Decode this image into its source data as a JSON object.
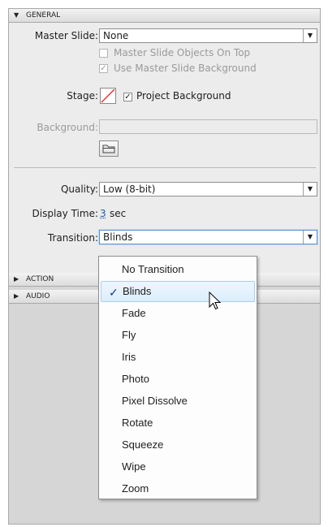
{
  "sections": {
    "general": "GENERAL",
    "action": "ACTION",
    "audio": "AUDIO"
  },
  "general": {
    "master_slide_label": "Master Slide:",
    "master_slide_value": "None",
    "master_objects_on_top": {
      "label": "Master Slide Objects On Top",
      "checked": false,
      "enabled": false
    },
    "use_master_bg": {
      "label": "Use Master Slide Background",
      "checked": true,
      "enabled": false
    },
    "stage_label": "Stage:",
    "project_background": {
      "label": "Project Background",
      "checked": true
    },
    "background_label": "Background:",
    "background_value": "",
    "quality_label": "Quality:",
    "quality_value": "Low (8-bit)",
    "display_time_label": "Display Time:",
    "display_time_value": "3",
    "display_time_unit": "sec",
    "transition_label": "Transition:",
    "transition_value": "Blinds"
  },
  "transition_options": [
    "No Transition",
    "Blinds",
    "Fade",
    "Fly",
    "Iris",
    "Photo",
    "Pixel Dissolve",
    "Rotate",
    "Squeeze",
    "Wipe",
    "Zoom"
  ],
  "selected_transition": "Blinds",
  "icons": {
    "collapse": "triangle-down-icon",
    "expand": "triangle-right-icon",
    "folder": "folder-icon",
    "cursor": "mouse-pointer-icon",
    "checkmark": "checkmark-icon"
  }
}
